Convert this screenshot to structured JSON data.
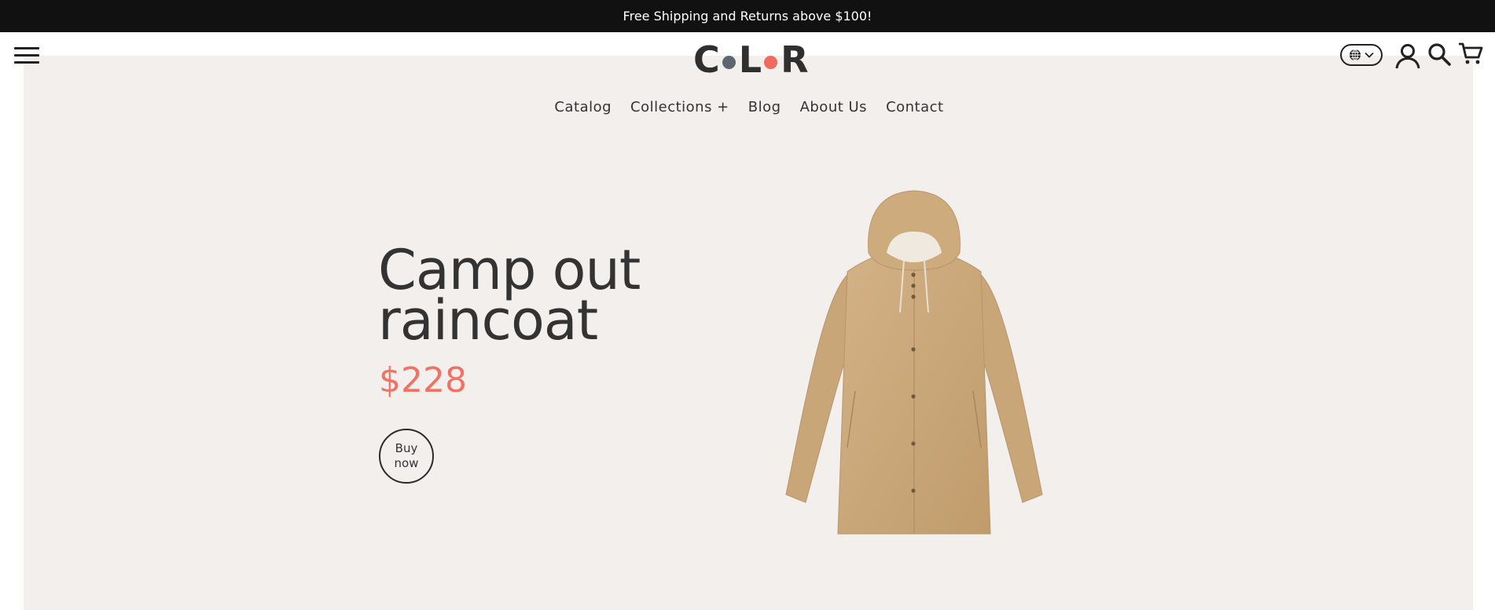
{
  "announcement": {
    "text": "Free Shipping and Returns above $100!"
  },
  "logo": {
    "letters": [
      "C",
      "L",
      "R"
    ],
    "alt": "COLOR",
    "dot_colors": [
      "#5d6670",
      "#ef6b5e"
    ]
  },
  "nav": {
    "items": [
      {
        "label": "Catalog"
      },
      {
        "label": "Collections +"
      },
      {
        "label": "Blog"
      },
      {
        "label": "About Us"
      },
      {
        "label": "Contact"
      }
    ]
  },
  "header_icons": [
    "menu-icon",
    "globe-icon",
    "chevron-down-icon",
    "account-icon",
    "search-icon",
    "cart-icon"
  ],
  "hero": {
    "title_line1": "Camp out",
    "title_line2": "raincoat",
    "price": "$228",
    "buy_label": "Buy now",
    "product_image": "tan-hooded-raincoat"
  },
  "colors": {
    "accent": "#ef7265",
    "hero_bg": "#f2efed",
    "topbar": "#111111"
  }
}
